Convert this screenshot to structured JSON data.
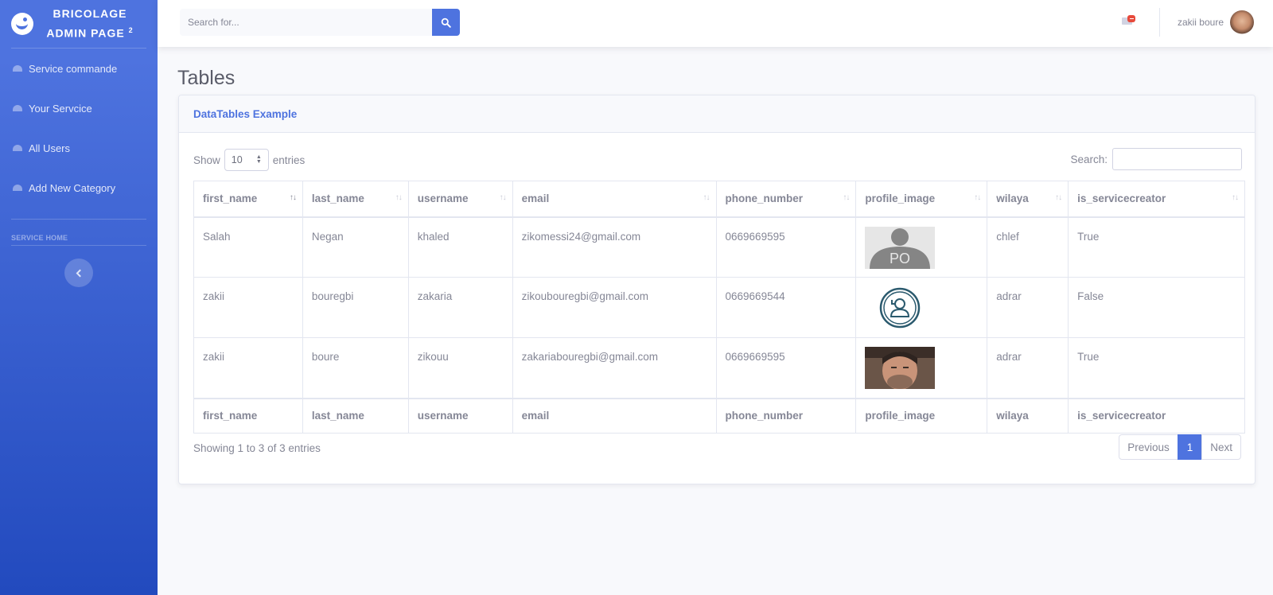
{
  "brand": {
    "line1": "BRICOLAGE",
    "line2": "ADMIN PAGE",
    "sup": "2"
  },
  "sidebar": {
    "items": [
      {
        "label": "Service commande"
      },
      {
        "label": "Your Servcice"
      },
      {
        "label": "All Users"
      },
      {
        "label": "Add New Category"
      }
    ],
    "heading": "SERVICE HOME"
  },
  "topbar": {
    "search_placeholder": "Search for...",
    "user_name": "zakii boure"
  },
  "page": {
    "title": "Tables"
  },
  "card": {
    "title": "DataTables Example",
    "length": {
      "show": "Show",
      "value": "10",
      "entries": "entries"
    },
    "search_label": "Search:",
    "columns": [
      "first_name",
      "last_name",
      "username",
      "email",
      "phone_number",
      "profile_image",
      "wilaya",
      "is_servicecreator"
    ],
    "rows": [
      {
        "first_name": "Salah",
        "last_name": "Negan",
        "username": "khaled",
        "email": "zikomessi24@gmail.com",
        "phone_number": "0669669595",
        "profile_image": "placeholder-po-image",
        "wilaya": "chlef",
        "is_servicecreator": "True"
      },
      {
        "first_name": "zakii",
        "last_name": "bouregbi",
        "username": "zakaria",
        "email": "zikoubouregbi@gmail.com",
        "phone_number": "0669669544",
        "profile_image": "user-circle-icon-image",
        "wilaya": "adrar",
        "is_servicecreator": "False"
      },
      {
        "first_name": "zakii",
        "last_name": "boure",
        "username": "zikouu",
        "email": "zakariabouregbi@gmail.com",
        "phone_number": "0669669595",
        "profile_image": "face-photo-image",
        "wilaya": "adrar",
        "is_servicecreator": "True"
      }
    ],
    "info": "Showing 1 to 3 of 3 entries",
    "pagination": {
      "previous": "Previous",
      "current": "1",
      "next": "Next"
    }
  },
  "colors": {
    "primary": "#4e73df",
    "sidebar_dark": "#224abe",
    "badge": "#e74a3b",
    "text": "#858796"
  },
  "icons": {
    "brand": "laugh-wink-icon",
    "nav": "tachometer-icon",
    "search": "search-icon",
    "mail": "envelope-icon",
    "toggle": "chevron-left-icon"
  }
}
